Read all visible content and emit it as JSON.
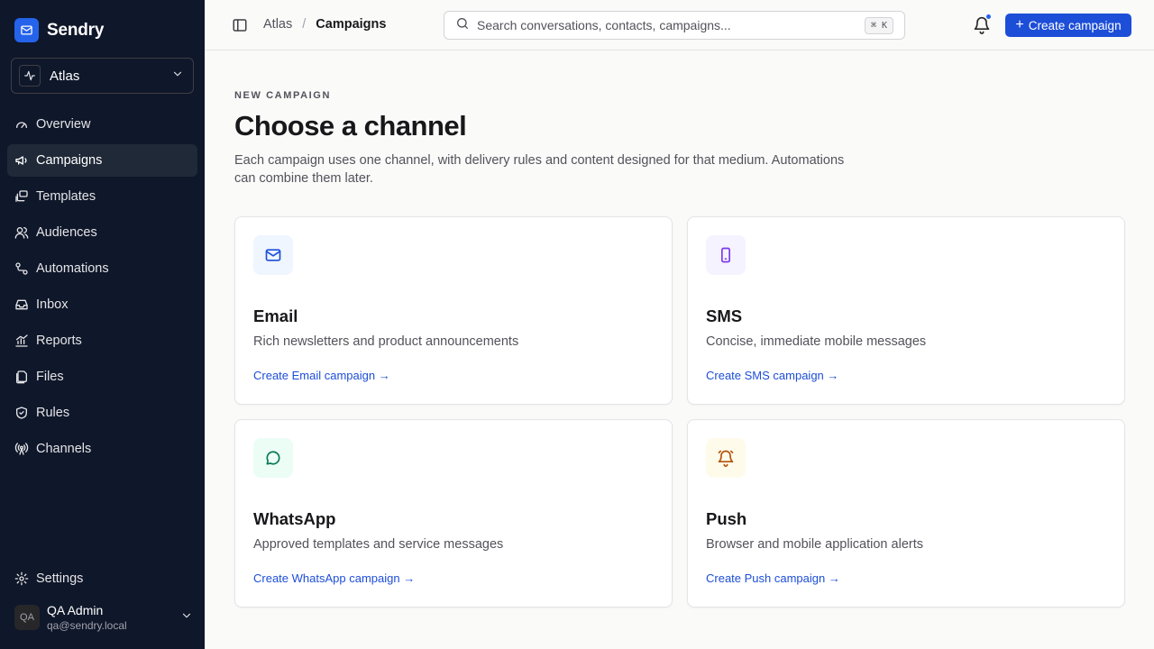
{
  "app": {
    "name": "Sendry",
    "workspace": "Atlas"
  },
  "sidebar": {
    "items": [
      {
        "label": "Overview",
        "icon": "gauge-icon",
        "active": false
      },
      {
        "label": "Campaigns",
        "icon": "megaphone-icon",
        "active": true
      },
      {
        "label": "Templates",
        "icon": "templates-icon",
        "active": false
      },
      {
        "label": "Audiences",
        "icon": "users-icon",
        "active": false
      },
      {
        "label": "Automations",
        "icon": "workflow-icon",
        "active": false
      },
      {
        "label": "Inbox",
        "icon": "inbox-icon",
        "active": false
      },
      {
        "label": "Reports",
        "icon": "chart-icon",
        "active": false
      },
      {
        "label": "Files",
        "icon": "files-icon",
        "active": false
      },
      {
        "label": "Rules",
        "icon": "shield-icon",
        "active": false
      },
      {
        "label": "Channels",
        "icon": "antenna-icon",
        "active": false
      }
    ],
    "settings": {
      "label": "Settings",
      "icon": "gear-icon"
    },
    "user": {
      "initials": "QA",
      "name": "QA Admin",
      "email": "qa@sendry.local"
    }
  },
  "header": {
    "breadcrumb": {
      "parent": "Atlas",
      "separator": "/",
      "current": "Campaigns"
    },
    "search": {
      "placeholder": "Search conversations, contacts, campaigns...",
      "shortcut": "⌘ K"
    },
    "notification_dot": true,
    "create_label": "Create campaign"
  },
  "main": {
    "eyebrow": "NEW CAMPAIGN",
    "title": "Choose a channel",
    "description": "Each campaign uses one channel, with delivery rules and content designed for that medium. Automations can combine them later.",
    "channels": [
      {
        "title": "Email",
        "description": "Rich newsletters and product announcements",
        "link": "Create Email campaign →",
        "icon": "mail-icon",
        "icon_bg": "#eff6ff",
        "icon_color": "#1d4ed8"
      },
      {
        "title": "SMS",
        "description": "Concise, immediate mobile messages",
        "link": "Create SMS campaign →",
        "icon": "phone-icon",
        "icon_bg": "#f5f3ff",
        "icon_color": "#7c3aed"
      },
      {
        "title": "WhatsApp",
        "description": "Approved templates and service messages",
        "link": "Create WhatsApp campaign →",
        "icon": "chat-bubble-icon",
        "icon_bg": "#ecfdf5",
        "icon_color": "#047857"
      },
      {
        "title": "Push",
        "description": "Browser and mobile application alerts",
        "link": "Create Push campaign →",
        "icon": "bell-ring-icon",
        "icon_bg": "#fffbeb",
        "icon_color": "#b45309"
      }
    ]
  },
  "colors": {
    "sidebar_bg": "#0f172a",
    "accent": "#1d4ed8",
    "brand": "#2563eb"
  }
}
